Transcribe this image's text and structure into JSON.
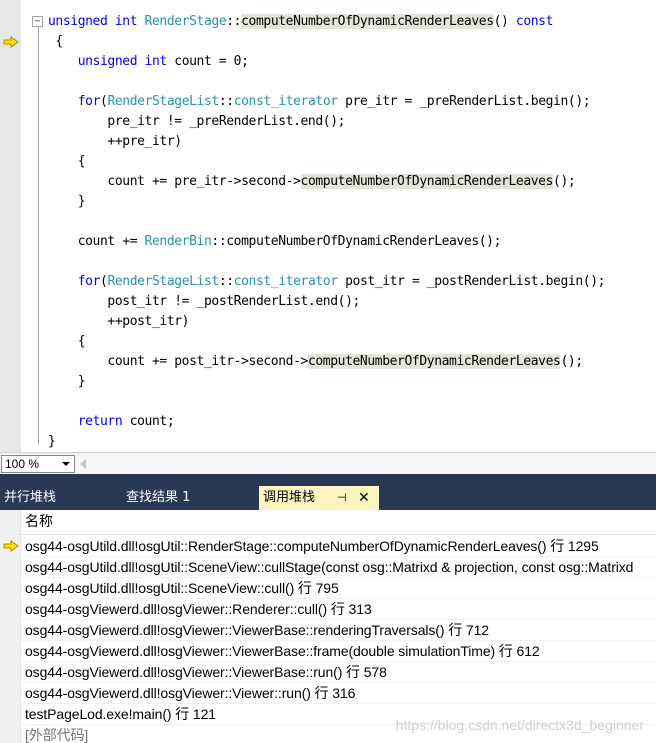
{
  "editor": {
    "code_lines": [
      [
        {
          "t": "unsigned int ",
          "c": "kw"
        },
        {
          "t": "RenderStage",
          "c": "ty"
        },
        {
          "t": "::"
        },
        {
          "t": "computeNumberOfDynamicRenderLeaves",
          "c": "hl"
        },
        {
          "t": "() "
        },
        {
          "t": "const",
          "c": "kw"
        }
      ],
      [
        {
          "t": " {"
        }
      ],
      [
        {
          "t": "    "
        },
        {
          "t": "unsigned int",
          "c": "kw"
        },
        {
          "t": " count = 0;"
        }
      ],
      [
        {
          "t": ""
        }
      ],
      [
        {
          "t": "    "
        },
        {
          "t": "for",
          "c": "kw"
        },
        {
          "t": "("
        },
        {
          "t": "RenderStageList",
          "c": "ty"
        },
        {
          "t": "::"
        },
        {
          "t": "const_iterator",
          "c": "ty"
        },
        {
          "t": " pre_itr = _preRenderList.begin();"
        }
      ],
      [
        {
          "t": "        pre_itr != _preRenderList.end();"
        }
      ],
      [
        {
          "t": "        ++pre_itr)"
        }
      ],
      [
        {
          "t": "    {"
        }
      ],
      [
        {
          "t": "        count += pre_itr->second->"
        },
        {
          "t": "computeNumberOfDynamicRenderLeaves",
          "c": "hl"
        },
        {
          "t": "();"
        }
      ],
      [
        {
          "t": "    }"
        }
      ],
      [
        {
          "t": ""
        }
      ],
      [
        {
          "t": "    count += "
        },
        {
          "t": "RenderBin",
          "c": "ty"
        },
        {
          "t": "::computeNumberOfDynamicRenderLeaves();"
        }
      ],
      [
        {
          "t": ""
        }
      ],
      [
        {
          "t": "    "
        },
        {
          "t": "for",
          "c": "kw"
        },
        {
          "t": "("
        },
        {
          "t": "RenderStageList",
          "c": "ty"
        },
        {
          "t": "::"
        },
        {
          "t": "const_iterator",
          "c": "ty"
        },
        {
          "t": " post_itr = _postRenderList.begin();"
        }
      ],
      [
        {
          "t": "        post_itr != _postRenderList.end();"
        }
      ],
      [
        {
          "t": "        ++post_itr)"
        }
      ],
      [
        {
          "t": "    {"
        }
      ],
      [
        {
          "t": "        count += post_itr->second->"
        },
        {
          "t": "computeNumberOfDynamicRenderLeaves",
          "c": "hl"
        },
        {
          "t": "();"
        }
      ],
      [
        {
          "t": "    }"
        }
      ],
      [
        {
          "t": ""
        }
      ],
      [
        {
          "t": "    "
        },
        {
          "t": "return",
          "c": "kw"
        },
        {
          "t": " count;"
        }
      ],
      [
        {
          "t": "}"
        }
      ]
    ],
    "fold_symbol": "−",
    "colors": {
      "keyword": "#0000ff",
      "type": "#2b91af",
      "highlight": "#e2e6d6",
      "gutter": "#e6e7e8"
    }
  },
  "zoom": {
    "value": "100 %"
  },
  "tabs": {
    "parallel_stacks": "并行堆栈",
    "find_results": "查找结果 1",
    "call_stack": "调用堆栈",
    "pin_glyph": "⊣",
    "close_glyph": "✕"
  },
  "callstack": {
    "header": "名称",
    "rows": [
      "osg44-osgUtild.dll!osgUtil::RenderStage::computeNumberOfDynamicRenderLeaves() 行 1295",
      "osg44-osgUtild.dll!osgUtil::SceneView::cullStage(const osg::Matrixd & projection, const osg::Matrixd",
      "osg44-osgUtild.dll!osgUtil::SceneView::cull() 行 795",
      "osg44-osgViewerd.dll!osgViewer::Renderer::cull() 行 313",
      "osg44-osgViewerd.dll!osgViewer::ViewerBase::renderingTraversals() 行 712",
      "osg44-osgViewerd.dll!osgViewer::ViewerBase::frame(double simulationTime) 行 612",
      "osg44-osgViewerd.dll!osgViewer::ViewerBase::run() 行 578",
      "osg44-osgViewerd.dll!osgViewer::Viewer::run() 行 316",
      "testPageLod.exe!main() 行 121",
      "[外部代码]"
    ],
    "current_row": 0,
    "external_row": 9
  },
  "watermark": "https://blog.csdn.net/directx3d_beginner"
}
